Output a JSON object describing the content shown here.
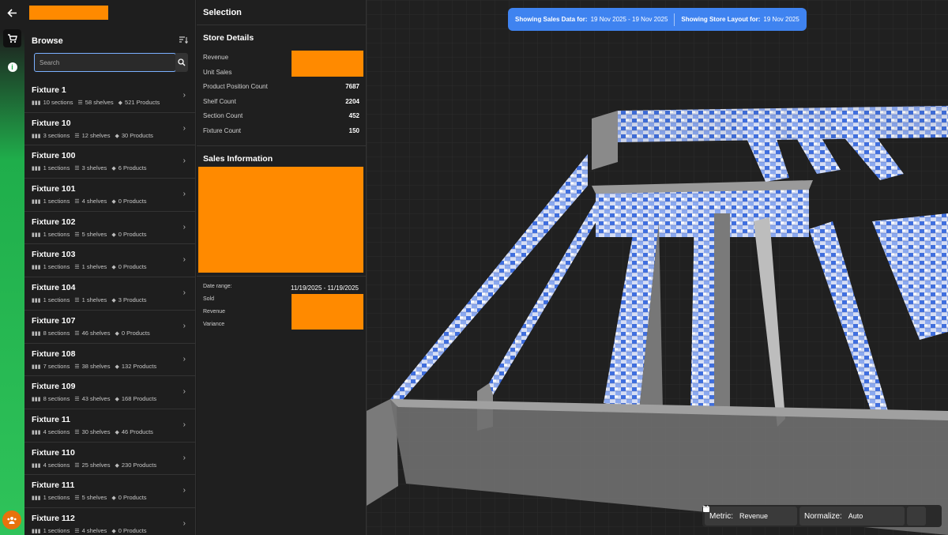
{
  "rail": {
    "back_icon": "arrow-left-icon",
    "cart_icon": "cart-icon",
    "info_icon": "info-icon",
    "info_glyph": "i",
    "user_icon": "users-icon"
  },
  "browse": {
    "title": "Browse",
    "search_placeholder": "Search",
    "items": [
      {
        "name": "Fixture 1",
        "sections": "10 sections",
        "shelves": "58 shelves",
        "products": "521 Products"
      },
      {
        "name": "Fixture 10",
        "sections": "3 sections",
        "shelves": "12 shelves",
        "products": "30 Products"
      },
      {
        "name": "Fixture 100",
        "sections": "1 sections",
        "shelves": "3 shelves",
        "products": "6 Products"
      },
      {
        "name": "Fixture 101",
        "sections": "1 sections",
        "shelves": "4 shelves",
        "products": "0 Products"
      },
      {
        "name": "Fixture 102",
        "sections": "1 sections",
        "shelves": "5 shelves",
        "products": "0 Products"
      },
      {
        "name": "Fixture 103",
        "sections": "1 sections",
        "shelves": "1 shelves",
        "products": "0 Products"
      },
      {
        "name": "Fixture 104",
        "sections": "1 sections",
        "shelves": "1 shelves",
        "products": "3 Products"
      },
      {
        "name": "Fixture 107",
        "sections": "8 sections",
        "shelves": "46 shelves",
        "products": "0 Products"
      },
      {
        "name": "Fixture 108",
        "sections": "7 sections",
        "shelves": "38 shelves",
        "products": "132 Products"
      },
      {
        "name": "Fixture 109",
        "sections": "8 sections",
        "shelves": "43 shelves",
        "products": "168 Products"
      },
      {
        "name": "Fixture 11",
        "sections": "4 sections",
        "shelves": "30 shelves",
        "products": "46 Products"
      },
      {
        "name": "Fixture 110",
        "sections": "4 sections",
        "shelves": "25 shelves",
        "products": "230 Products"
      },
      {
        "name": "Fixture 111",
        "sections": "1 sections",
        "shelves": "5 shelves",
        "products": "0 Products"
      },
      {
        "name": "Fixture 112",
        "sections": "1 sections",
        "shelves": "4 shelves",
        "products": "0 Products"
      }
    ]
  },
  "selection": {
    "title": "Selection",
    "store_details_title": "Store Details",
    "revenue_label": "Revenue",
    "unit_sales_label": "Unit Sales",
    "ppc_label": "Product Position Count",
    "ppc_value": "7687",
    "shelf_label": "Shelf Count",
    "shelf_value": "2204",
    "section_label": "Section Count",
    "section_value": "452",
    "fixture_label": "Fixture Count",
    "fixture_value": "150",
    "sales_info_title": "Sales Information",
    "date_range_label": "Date range:",
    "date_range_value": "11/19/2025 - 11/19/2025",
    "sold_label": "Sold",
    "revenue2_label": "Revenue",
    "variance_label": "Variance"
  },
  "banner": {
    "sales_label": "Showing Sales Data for:",
    "sales_value": "19 Nov 2025 - 19 Nov 2025",
    "layout_label": "Showing Store Layout for:",
    "layout_value": "19 Nov 2025"
  },
  "controls": {
    "metric_label": "Metric:",
    "metric_value": "Revenue",
    "normalize_label": "Normalize:",
    "normalize_value": "Auto",
    "calendar_icon": "calendar-icon"
  },
  "colors": {
    "accent_green": "#1fae4b",
    "redaction": "#ff8a00",
    "banner_blue": "#3f83f0"
  }
}
